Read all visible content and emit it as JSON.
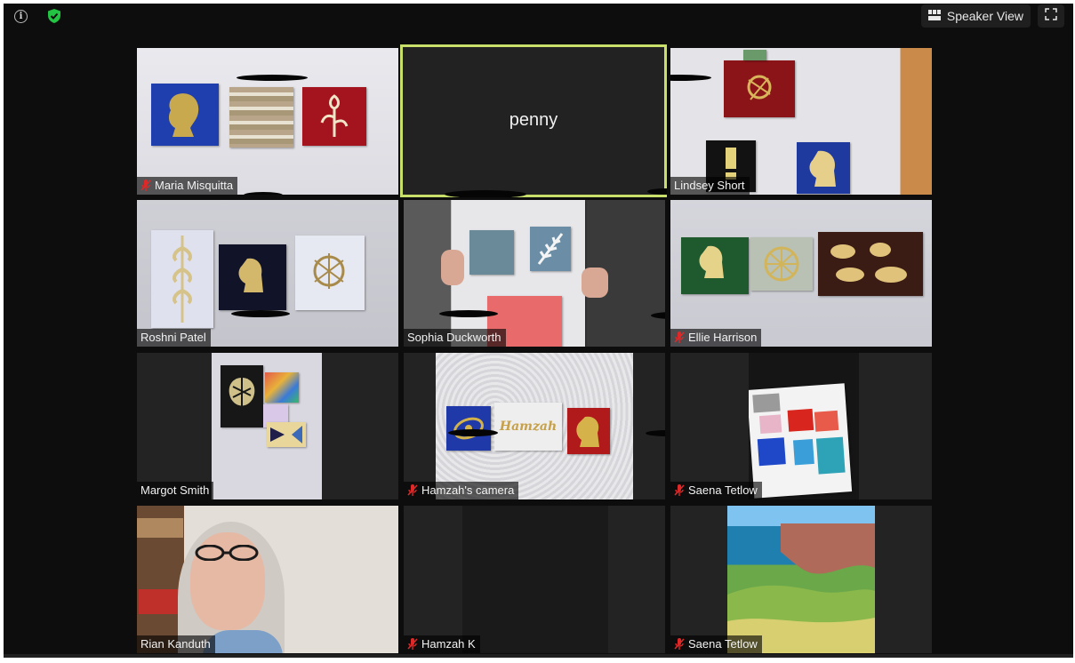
{
  "header": {
    "view_label": "Speaker View",
    "icons": {
      "info": "info-icon",
      "security": "shield-check-icon",
      "view": "grid-icon",
      "fullscreen": "fullscreen-icon"
    },
    "security_color": "#23c343"
  },
  "active_speaker_color": "#c8e06a",
  "participants": [
    {
      "name": "Maria Misquitta",
      "muted": true
    },
    {
      "name": "penny",
      "muted": false,
      "video_off": true
    },
    {
      "name": "Lindsey Short",
      "muted": false
    },
    {
      "name": "Roshni Patel",
      "muted": false
    },
    {
      "name": "Sophia Duckworth",
      "muted": false
    },
    {
      "name": "Ellie Harrison",
      "muted": true
    },
    {
      "name": "Margot Smith",
      "muted": false
    },
    {
      "name": "Hamzah's camera",
      "muted": true
    },
    {
      "name": "Saena Tetlow",
      "muted": true
    },
    {
      "name": "Rian Kanduth",
      "muted": false
    },
    {
      "name": "Hamzah K",
      "muted": true
    },
    {
      "name": "Saena Tetlow",
      "muted": true
    }
  ],
  "artwork_text": "Hamzah",
  "muted_color": "#e02828"
}
